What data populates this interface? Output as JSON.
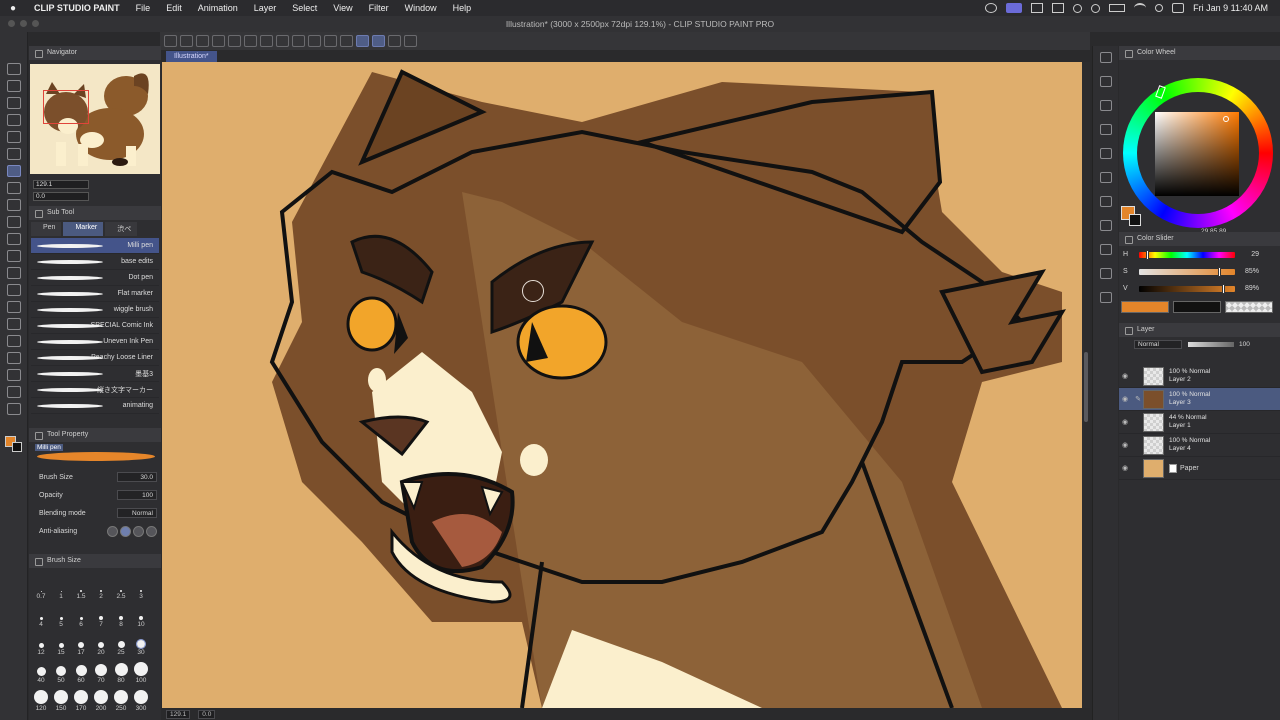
{
  "menubar": {
    "app_name": "CLIP STUDIO PAINT",
    "menus": [
      "File",
      "Edit",
      "Animation",
      "Layer",
      "Select",
      "View",
      "Filter",
      "Window",
      "Help"
    ],
    "clock": "Fri Jan 9  11:40 AM"
  },
  "window": {
    "title": "Illustration* (3000 x 2500px 72dpi 129.1%)  - CLIP STUDIO PAINT PRO"
  },
  "canvas": {
    "tab_label": "Illustration*",
    "status_zoom": "129.1",
    "status_angle": "0.0"
  },
  "navigator": {
    "title": "Navigator",
    "zoom": "129.1",
    "angle": "0.0"
  },
  "subtool": {
    "title": "Sub Tool",
    "tabs": [
      "Pen",
      "Marker",
      "渋ペ"
    ],
    "active_tab": 1,
    "brushes": [
      {
        "name": "Milli pen",
        "selected": true
      },
      {
        "name": "base edits",
        "selected": false
      },
      {
        "name": "Dot pen",
        "selected": false
      },
      {
        "name": "Flat marker",
        "selected": false
      },
      {
        "name": "wiggle brush",
        "selected": false
      },
      {
        "name": "SPECIAL Comic Ink",
        "selected": false
      },
      {
        "name": "Uneven Ink Pen",
        "selected": false
      },
      {
        "name": "Peachy Loose Liner",
        "selected": false
      },
      {
        "name": "墨基3",
        "selected": false
      },
      {
        "name": "縦き文字マーカー",
        "selected": false
      },
      {
        "name": "animating",
        "selected": false
      }
    ]
  },
  "tool_property": {
    "title": "Tool Property",
    "brush_name": "Milli pen",
    "brush_size_label": "Brush Size",
    "brush_size_value": "30.0",
    "opacity_label": "Opacity",
    "opacity_value": "100",
    "blending_label": "Blending mode",
    "blending_value": "Normal",
    "antialias_label": "Anti-aliasing",
    "antialias_level": 1
  },
  "brush_size_panel": {
    "title": "Brush Size",
    "sizes": [
      "0.7",
      "1",
      "1.5",
      "2",
      "2.5",
      "3",
      "4",
      "5",
      "6",
      "7",
      "8",
      "10",
      "12",
      "15",
      "17",
      "20",
      "25",
      "30",
      "40",
      "50",
      "60",
      "70",
      "80",
      "100",
      "120",
      "150",
      "170",
      "200",
      "250",
      "300"
    ],
    "selected": "30"
  },
  "color_wheel": {
    "title": "Color Wheel",
    "main_color": "#e3852a",
    "sub_color": "#111111",
    "hsv_readout": "29  85  89"
  },
  "color_slider": {
    "title": "Color Slider",
    "h_label": "H",
    "h_value": "29",
    "s_label": "S",
    "s_value": "85%",
    "v_label": "V",
    "v_value": "89%",
    "h_fraction": 0.08,
    "s_fraction": 0.85,
    "v_fraction": 0.89
  },
  "layer_panel": {
    "title": "Layer",
    "blend_mode": "Normal",
    "opacity": "100",
    "layers": [
      {
        "opacity_mode": "100 % Normal",
        "name": "Layer 2",
        "selected": false,
        "editing": false,
        "thumb": "empty"
      },
      {
        "opacity_mode": "100 % Normal",
        "name": "Layer 3",
        "selected": true,
        "editing": true,
        "thumb": "art"
      },
      {
        "opacity_mode": "44 % Normal",
        "name": "Layer 1",
        "selected": false,
        "editing": false,
        "thumb": "empty"
      },
      {
        "opacity_mode": "100 % Normal",
        "name": "Layer 4",
        "selected": false,
        "editing": false,
        "thumb": "empty"
      }
    ],
    "paper_name": "Paper"
  },
  "colors": {
    "accent": "#4b5a80",
    "canvas_bg": "#dfae6d",
    "fur_dark": "#7b4f2b",
    "fur_mid": "#8d6238",
    "eye": "#f2a52a",
    "cream": "#fbefcd"
  }
}
